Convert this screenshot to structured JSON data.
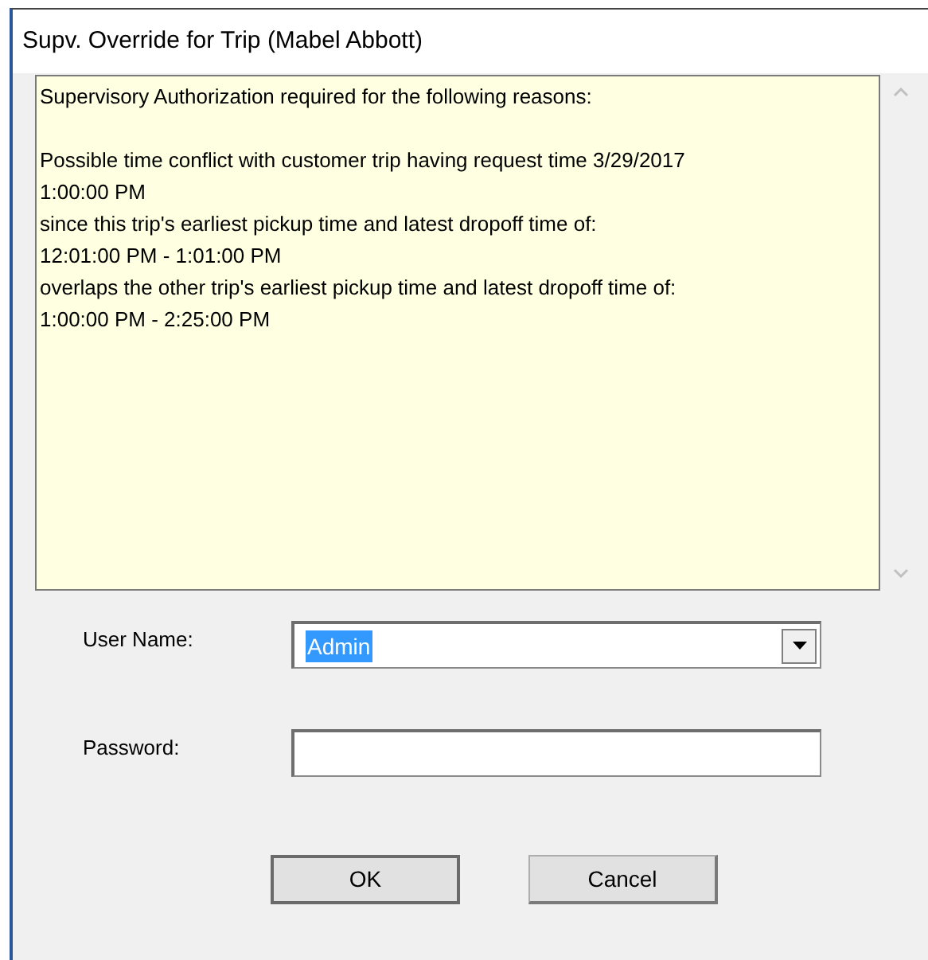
{
  "window": {
    "title": "Supv. Override for Trip (Mabel Abbott)"
  },
  "message_heading": "Supervisory Authorization required for the following reasons:",
  "message_lines": [
    "Possible time conflict with customer trip having request time 3/29/2017",
    "1:00:00 PM",
    "since this trip's earliest pickup time and latest dropoff time of:",
    "12:01:00 PM - 1:01:00 PM",
    "overlaps the other trip's earliest pickup time and latest dropoff time of:",
    "1:00:00 PM - 2:25:00 PM"
  ],
  "user_name": {
    "label": "User Name:",
    "value": "Admin",
    "selected": true
  },
  "password": {
    "label": "Password:"
  },
  "buttons": [
    {
      "label": "OK"
    },
    {
      "label": "Cancel"
    }
  ]
}
